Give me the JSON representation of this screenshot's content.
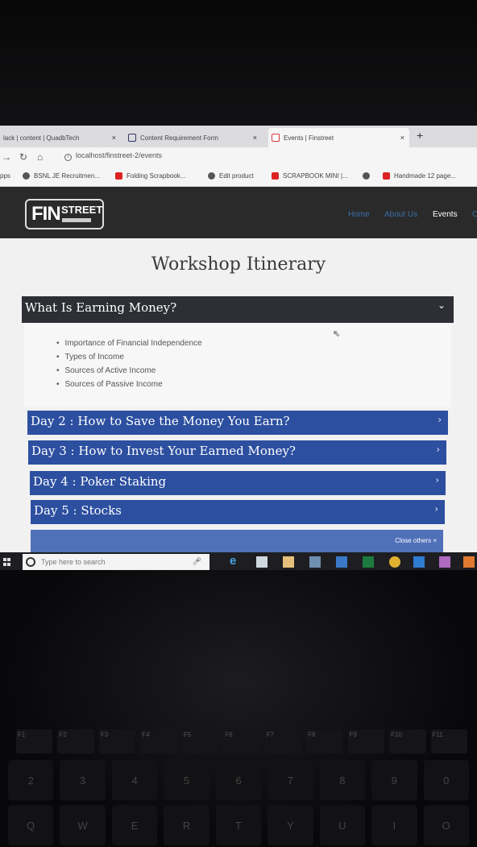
{
  "browser": {
    "tabs": [
      {
        "label": "lack | content | QuadbTech",
        "close": "×"
      },
      {
        "label": "Content Requirement Form",
        "close": "×"
      },
      {
        "label": "Events | Finstreet",
        "close": "×"
      }
    ],
    "new_tab": "+",
    "url": "localhost/finstreet-2/events",
    "bookmarks": [
      {
        "label": "pps"
      },
      {
        "label": "BSNL JE Recruitmen..."
      },
      {
        "label": "Folding Scrapbook..."
      },
      {
        "label": "Edit product"
      },
      {
        "label": "SCRAPBOOK MINI |..."
      },
      {
        "label": "Handmade 12 page..."
      }
    ]
  },
  "site": {
    "logo_fin": "FIN",
    "logo_street": "STREET",
    "nav": [
      {
        "label": "Home"
      },
      {
        "label": "About Us"
      },
      {
        "label": "Events"
      },
      {
        "label": "C"
      }
    ]
  },
  "page": {
    "title": "Workshop Itinerary",
    "open_section": {
      "title": "What Is Earning Money?",
      "items": [
        "Importance of Financial Independence",
        "Types of Income",
        "Sources of Active Income",
        "Sources of Passive Income"
      ]
    },
    "sections": [
      {
        "title": "Day 2 : How to Save the Money You Earn?"
      },
      {
        "title": "Day 3 : How to Invest Your Earned Money?"
      },
      {
        "title": "Day 4 : Poker Staking"
      },
      {
        "title": "Day 5 : Stocks"
      }
    ],
    "close_others": "Close others ×"
  },
  "taskbar": {
    "search_placeholder": "Type here to search"
  },
  "keyboard": {
    "fkeys": [
      "F1",
      "F2",
      "F3",
      "F4",
      "F5",
      "F6",
      "F7",
      "F8",
      "F9",
      "F10",
      "F11"
    ],
    "row1": [
      "2",
      "3",
      "4",
      "5",
      "6",
      "7",
      "8",
      "9",
      "0"
    ],
    "row2": [
      "Q",
      "W",
      "E",
      "R",
      "T",
      "Y",
      "U",
      "I",
      "O"
    ]
  },
  "colors": {
    "accordion_blue": "#2c4fa0",
    "accordion_dark": "#2d2f35",
    "site_header": "#2a2a2a"
  }
}
